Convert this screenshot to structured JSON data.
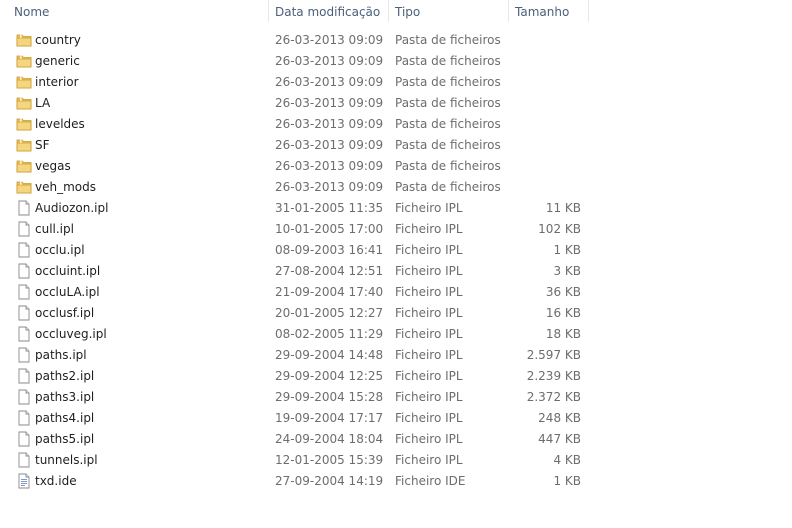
{
  "columns": {
    "name": "Nome",
    "date": "Data modificação",
    "type": "Tipo",
    "size": "Tamanho"
  },
  "icons": {
    "sort": "chevron-up-icon",
    "folder": "folder-icon",
    "file": "file-icon",
    "ide": "ide-file-icon"
  },
  "colors": {
    "header_text": "#4c607a",
    "folder": "#e9c15a",
    "detail_text": "#6d6d6d"
  },
  "items": [
    {
      "name": "country",
      "date": "26-03-2013 09:09",
      "type": "Pasta de ficheiros",
      "size": "",
      "kind": "folder"
    },
    {
      "name": "generic",
      "date": "26-03-2013 09:09",
      "type": "Pasta de ficheiros",
      "size": "",
      "kind": "folder"
    },
    {
      "name": "interior",
      "date": "26-03-2013 09:09",
      "type": "Pasta de ficheiros",
      "size": "",
      "kind": "folder"
    },
    {
      "name": "LA",
      "date": "26-03-2013 09:09",
      "type": "Pasta de ficheiros",
      "size": "",
      "kind": "folder"
    },
    {
      "name": "leveldes",
      "date": "26-03-2013 09:09",
      "type": "Pasta de ficheiros",
      "size": "",
      "kind": "folder"
    },
    {
      "name": "SF",
      "date": "26-03-2013 09:09",
      "type": "Pasta de ficheiros",
      "size": "",
      "kind": "folder"
    },
    {
      "name": "vegas",
      "date": "26-03-2013 09:09",
      "type": "Pasta de ficheiros",
      "size": "",
      "kind": "folder"
    },
    {
      "name": "veh_mods",
      "date": "26-03-2013 09:09",
      "type": "Pasta de ficheiros",
      "size": "",
      "kind": "folder"
    },
    {
      "name": "Audiozon.ipl",
      "date": "31-01-2005 11:35",
      "type": "Ficheiro IPL",
      "size": "11 KB",
      "kind": "file"
    },
    {
      "name": "cull.ipl",
      "date": "10-01-2005 17:00",
      "type": "Ficheiro IPL",
      "size": "102 KB",
      "kind": "file"
    },
    {
      "name": "occlu.ipl",
      "date": "08-09-2003 16:41",
      "type": "Ficheiro IPL",
      "size": "1 KB",
      "kind": "file"
    },
    {
      "name": "occluint.ipl",
      "date": "27-08-2004 12:51",
      "type": "Ficheiro IPL",
      "size": "3 KB",
      "kind": "file"
    },
    {
      "name": "occluLA.ipl",
      "date": "21-09-2004 17:40",
      "type": "Ficheiro IPL",
      "size": "36 KB",
      "kind": "file"
    },
    {
      "name": "occlusf.ipl",
      "date": "20-01-2005 12:27",
      "type": "Ficheiro IPL",
      "size": "16 KB",
      "kind": "file"
    },
    {
      "name": "occluveg.ipl",
      "date": "08-02-2005 11:29",
      "type": "Ficheiro IPL",
      "size": "18 KB",
      "kind": "file"
    },
    {
      "name": "paths.ipl",
      "date": "29-09-2004 14:48",
      "type": "Ficheiro IPL",
      "size": "2.597 KB",
      "kind": "file"
    },
    {
      "name": "paths2.ipl",
      "date": "29-09-2004 12:25",
      "type": "Ficheiro IPL",
      "size": "2.239 KB",
      "kind": "file"
    },
    {
      "name": "paths3.ipl",
      "date": "29-09-2004 15:28",
      "type": "Ficheiro IPL",
      "size": "2.372 KB",
      "kind": "file"
    },
    {
      "name": "paths4.ipl",
      "date": "19-09-2004 17:17",
      "type": "Ficheiro IPL",
      "size": "248 KB",
      "kind": "file"
    },
    {
      "name": "paths5.ipl",
      "date": "24-09-2004 18:04",
      "type": "Ficheiro IPL",
      "size": "447 KB",
      "kind": "file"
    },
    {
      "name": "tunnels.ipl",
      "date": "12-01-2005 15:39",
      "type": "Ficheiro IPL",
      "size": "4 KB",
      "kind": "file"
    },
    {
      "name": "txd.ide",
      "date": "27-09-2004 14:19",
      "type": "Ficheiro IDE",
      "size": "1 KB",
      "kind": "ide"
    }
  ]
}
